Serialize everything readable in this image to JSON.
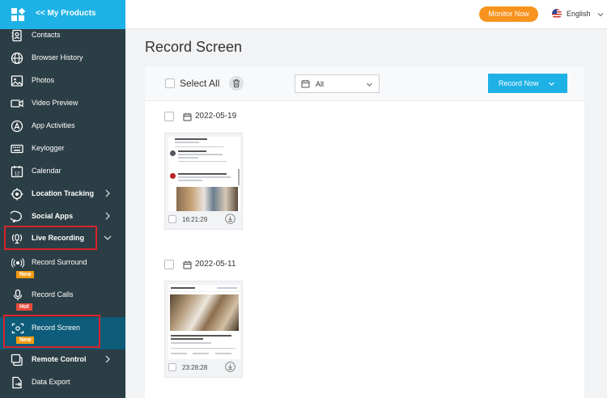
{
  "header": {
    "back_label": "<< My Products",
    "monitor_now": "Monitor Now",
    "language": "English"
  },
  "sidebar": {
    "items": [
      {
        "label": "Contacts",
        "icon": "contacts-icon"
      },
      {
        "label": "Browser History",
        "icon": "globe-icon"
      },
      {
        "label": "Photos",
        "icon": "image-icon"
      },
      {
        "label": "Video Preview",
        "icon": "video-icon"
      },
      {
        "label": "App Activities",
        "icon": "app-store-icon"
      },
      {
        "label": "Keylogger",
        "icon": "keyboard-icon"
      },
      {
        "label": "Calendar",
        "icon": "calendar-icon"
      },
      {
        "label": "Location Tracking",
        "icon": "location-icon"
      },
      {
        "label": "Social Apps",
        "icon": "chat-bubble-icon"
      },
      {
        "label": "Live Recording",
        "icon": "live-icon"
      },
      {
        "label": "Record Surround",
        "icon": "surround-icon",
        "badge": "New"
      },
      {
        "label": "Record Calls",
        "icon": "microphone-icon",
        "badge": "Hot"
      },
      {
        "label": "Record Screen",
        "icon": "screen-record-icon",
        "badge": "New"
      },
      {
        "label": "Remote Control",
        "icon": "remote-icon"
      },
      {
        "label": "Data Export",
        "icon": "export-icon"
      }
    ]
  },
  "main": {
    "title": "Record Screen",
    "select_all": "Select All",
    "filter": {
      "value": "All"
    },
    "record_now": "Record Now",
    "groups": [
      {
        "date": "2022-05-19",
        "recordings": [
          {
            "time": "16:21:29"
          }
        ]
      },
      {
        "date": "2022-05-11",
        "recordings": [
          {
            "time": "23:28:28"
          }
        ]
      }
    ]
  },
  "colors": {
    "accent": "#1eb1e6",
    "sidebar": "#2c3e45",
    "active": "#0d5c79",
    "monitor_button": "#f7931d",
    "highlight": "#d9232d"
  }
}
